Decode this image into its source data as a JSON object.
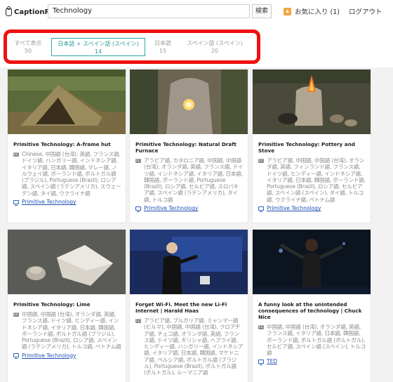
{
  "header": {
    "logo_text": "CaptionPop",
    "search_value": "Technology",
    "search_button": "検索",
    "favorites_label": "お気に入り (1)",
    "logout_label": "ログアウト"
  },
  "filters": [
    {
      "label": "すべて表示",
      "count": "50"
    },
    {
      "label": "日本語 + スペイン語 (スペイン)",
      "count": "14"
    },
    {
      "label": "日本語",
      "count": "15"
    },
    {
      "label": "スペイン語 (スペイン)",
      "count": "20"
    }
  ],
  "videos": [
    {
      "title": "Primitive Technology: A-frame hut",
      "languages": "Chinese, 中国語 (台湾), 英語, フランス語, ドイツ語, ハンガリー語, インドネシア語, イタリア語, 日本語, 韓国語, マレー語, ノルウェイ語, ポーランド語, ポルトガル語 (ブラジル), Portuguese (Brazil), ロシア語, スペイン語 (ラテンアメリカ), スウェーデン語, タイ語, ウクライナ語",
      "channel": "Primitive Technology"
    },
    {
      "title": "Primitive Technology: Natural Draft Furnace",
      "languages": "アラビア語, カタロニア語, 中国語, 中国語 (台湾), オランダ語, 英語, フランス語, ドイツ語, インドネシア語, イタリア語, 日本語, 韓国語, ポーランド語, Portuguese (Brazil), ロシア語, セルビア語, スロバキア語, スペイン語 (ラテンアメリカ), タイ語, トルコ語",
      "channel": "Primitive Technology"
    },
    {
      "title": "Primitive Technology: Pottery and Stove",
      "languages": "アラビア語, 中国語, 中国語 (台湾), オランダ語, 英語, フィンランド語, フランス語, ドイツ語, ヒンディー語, インドネシア語, イタリア語, 日本語, 韓国語, ポーランド語, Portuguese (Brazil), ロシア語, セルビア語, スペイン語 (スペイン), タイ語, トルコ語, ウクライナ語, ベトナム語",
      "channel": "Primitive Technology"
    },
    {
      "title": "Primitive Technology: Lime",
      "languages": "中国語, 中国語 (台湾), オランダ語, 英語, フランス語, ドイツ語, ヒンディー語, インドネシア語, イタリア語, 日本語, 韓国語, ポーランド語, ポルトガル語 (ブラジル), Portuguese (Brazil), ロシア語, スペイン語 (ラテンアメリカ), トルコ語, ベトナム語",
      "channel": "Primitive Technology"
    },
    {
      "title": "Forget Wi-Fi. Meet the new Li-Fi Internet | Harald Haas",
      "languages": "アラビア語, ブルガリア語, ミャンマー語 (ビルマ), 中国語, 中国語 (台湾), クロアチア語, チェコ語, オランダ語, 英語, フランス語, ドイツ語, ギリシャ語, ヘブライ語, ヒンディー語, ハンガリー語, インドネシア語, イタリア語, 日本語, 韓国語, マケドニア語, ペルシア語, ポルトガル語 (ブラジル), Portuguese (Brazil), ポルトガル語 (ポルトガル), ルーマニア語",
      "channel": "TED"
    },
    {
      "title": "A funny look at the unintended consequences of technology | Chuck Nice",
      "languages": "中国語, 中国語 (台湾), オランダ語, 英語, フランス語, イタリア語, 日本語, 韓国語, ポーランド語, ポルトガル語 (ポルトガル), セルビア語, スペイン語 (スペイン), トルコ語",
      "channel": "TED"
    }
  ]
}
